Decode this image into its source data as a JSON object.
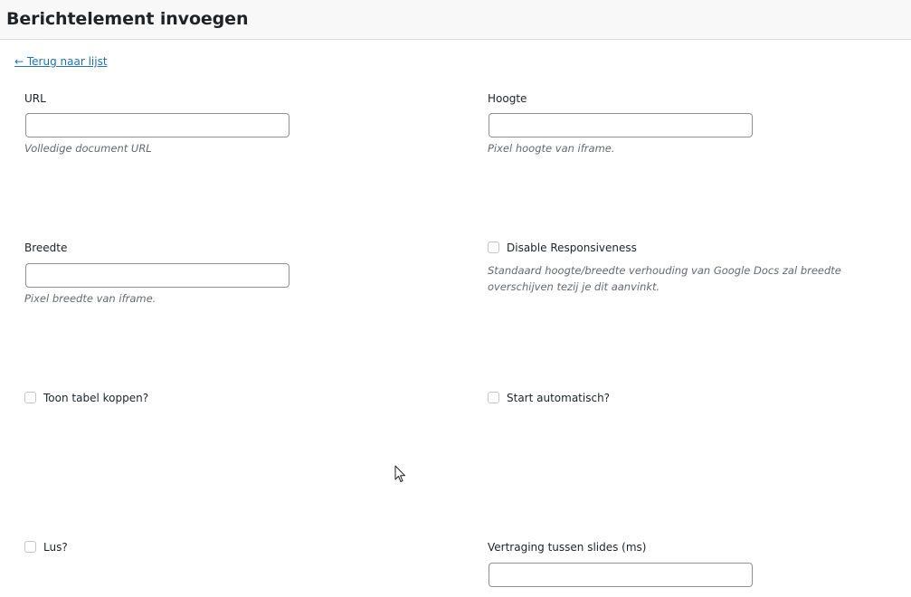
{
  "header": {
    "title": "Berichtelement invoegen"
  },
  "back_link": {
    "label": "← Terug naar lijst"
  },
  "fields": {
    "url": {
      "label": "URL",
      "value": "",
      "help": "Volledige document URL"
    },
    "height": {
      "label": "Hoogte",
      "value": "",
      "help": "Pixel hoogte van iframe."
    },
    "width": {
      "label": "Breedte",
      "value": "",
      "help": "Pixel breedte van iframe."
    },
    "disable_responsiveness": {
      "label": "Disable Responsiveness",
      "checked": false,
      "help": "Standaard hoogte/breedte verhouding van Google Docs zal breedte overschijven tezij je dit aanvinkt."
    },
    "show_table_headers": {
      "label": "Toon tabel koppen?",
      "checked": false
    },
    "autostart": {
      "label": "Start automatisch?",
      "checked": false
    },
    "loop": {
      "label": "Lus?",
      "checked": false
    },
    "slide_delay": {
      "label": "Vertraging tussen slides (ms)",
      "value": ""
    }
  },
  "colors": {
    "link": "#2271b1",
    "header_bg": "#f8f8f8",
    "input_border": "#8c8f94",
    "help_text": "#646970"
  }
}
